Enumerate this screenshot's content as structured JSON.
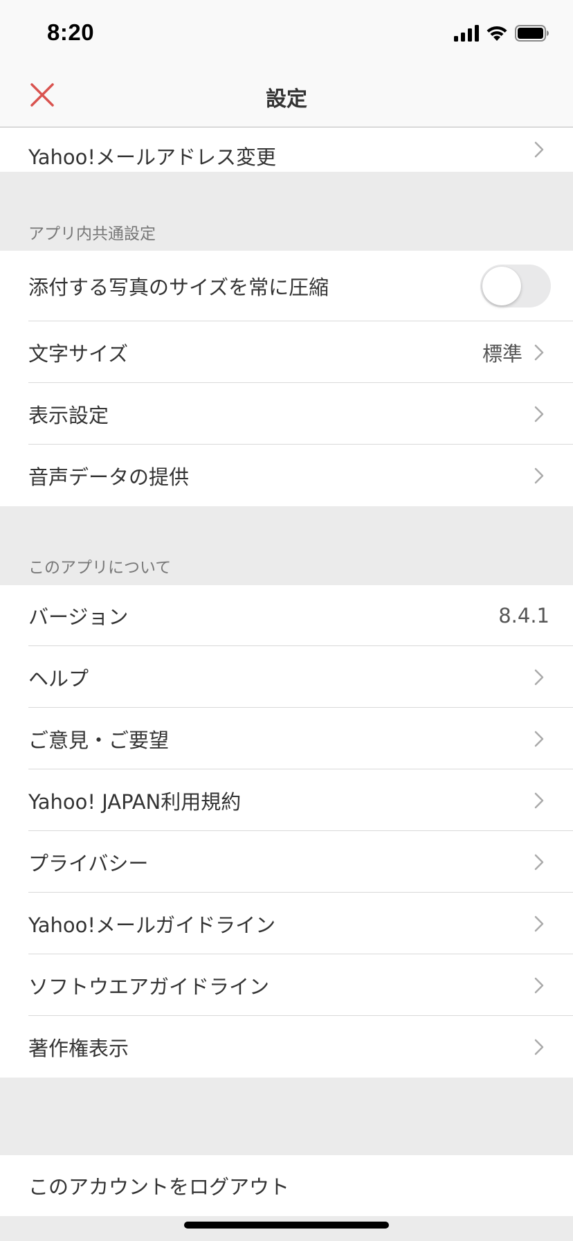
{
  "status_bar": {
    "time": "8:20"
  },
  "nav": {
    "title": "設定"
  },
  "rows": {
    "mail_address_change": "Yahoo!メールアドレス変更",
    "compress_photos": "添付する写真のサイズを常に圧縮",
    "text_size": "文字サイズ",
    "text_size_value": "標準",
    "display_settings": "表示設定",
    "voice_data": "音声データの提供",
    "version": "バージョン",
    "version_value": "8.4.1",
    "help": "ヘルプ",
    "feedback": "ご意見・ご要望",
    "terms": "Yahoo! JAPAN利用規約",
    "privacy": "プライバシー",
    "mail_guidelines": "Yahoo!メールガイドライン",
    "software_guidelines": "ソフトウエアガイドライン",
    "copyright": "著作権表示",
    "logout": "このアカウントをログアウト"
  },
  "sections": {
    "app_common": "アプリ内共通設定",
    "about_app": "このアプリについて"
  },
  "toggles": {
    "compress_photos_on": false
  },
  "colors": {
    "accent_close": "#d9534f",
    "background": "#ebebeb",
    "toggle_off": "#e9e9ea"
  },
  "icons": [
    "close-icon",
    "chevron-right-icon",
    "signal-icon",
    "wifi-icon",
    "battery-icon"
  ]
}
